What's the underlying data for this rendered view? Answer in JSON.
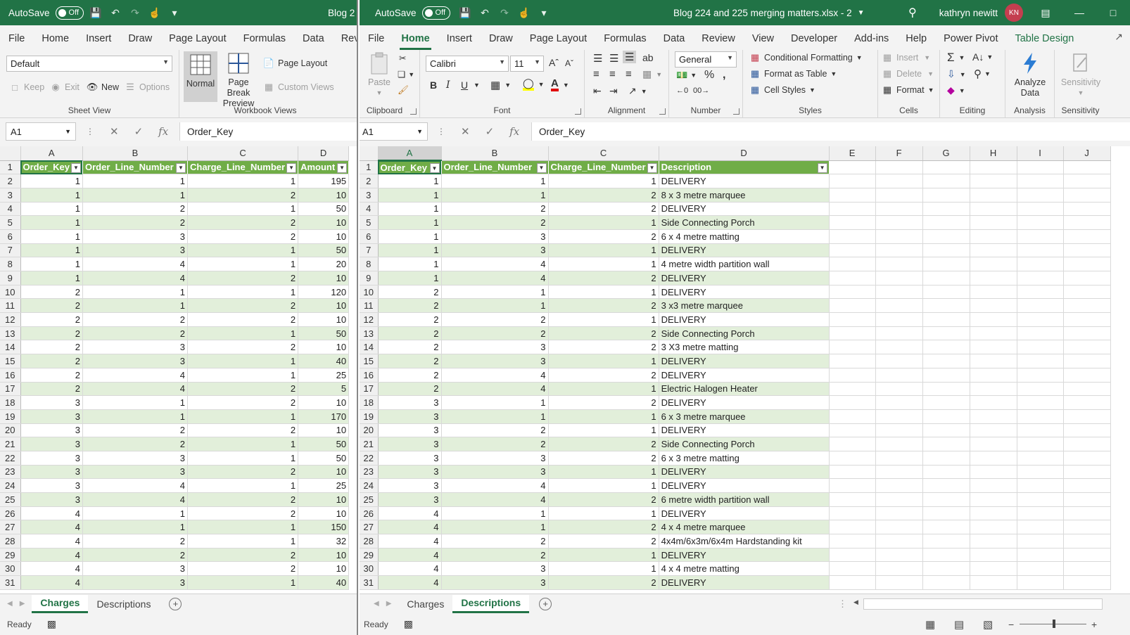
{
  "colors": {
    "excel_green": "#217346",
    "table_header": "#70ad47",
    "table_band": "#e2efda",
    "avatar": "#c43e4f"
  },
  "left": {
    "title": {
      "autosave_label": "AutoSave",
      "autosave_state": "Off",
      "doc_partial": "Blog 2"
    },
    "menu": [
      "File",
      "Home",
      "Insert",
      "Draw",
      "Page Layout",
      "Formulas",
      "Data",
      "Revi"
    ],
    "ribbon": {
      "sheet_view_value": "Default",
      "keep": "Keep",
      "exit": "Exit",
      "new": "New",
      "options": "Options",
      "sheet_view_group": "Sheet View",
      "normal": "Normal",
      "page_break_preview_1": "Page Break",
      "page_break_preview_2": "Preview",
      "page_layout": "Page Layout",
      "custom_views": "Custom Views",
      "workbook_views_group": "Workbook Views"
    },
    "formula": {
      "name_box": "A1",
      "value": "Order_Key"
    },
    "columns": [
      "A",
      "B",
      "C",
      "D"
    ],
    "headers": [
      "Order_Key",
      "Order_Line_Number",
      "Charge_Line_Number",
      "Amount"
    ],
    "rows": [
      [
        1,
        1,
        1,
        195
      ],
      [
        1,
        1,
        2,
        10
      ],
      [
        1,
        2,
        1,
        50
      ],
      [
        1,
        2,
        2,
        10
      ],
      [
        1,
        3,
        2,
        10
      ],
      [
        1,
        3,
        1,
        50
      ],
      [
        1,
        4,
        1,
        20
      ],
      [
        1,
        4,
        2,
        10
      ],
      [
        2,
        1,
        1,
        120
      ],
      [
        2,
        1,
        2,
        10
      ],
      [
        2,
        2,
        2,
        10
      ],
      [
        2,
        2,
        1,
        50
      ],
      [
        2,
        3,
        2,
        10
      ],
      [
        2,
        3,
        1,
        40
      ],
      [
        2,
        4,
        1,
        25
      ],
      [
        2,
        4,
        2,
        5
      ],
      [
        3,
        1,
        2,
        10
      ],
      [
        3,
        1,
        1,
        170
      ],
      [
        3,
        2,
        2,
        10
      ],
      [
        3,
        2,
        1,
        50
      ],
      [
        3,
        3,
        1,
        50
      ],
      [
        3,
        3,
        2,
        10
      ],
      [
        3,
        4,
        1,
        25
      ],
      [
        3,
        4,
        2,
        10
      ],
      [
        4,
        1,
        2,
        10
      ],
      [
        4,
        1,
        1,
        150
      ],
      [
        4,
        2,
        1,
        32
      ],
      [
        4,
        2,
        2,
        10
      ],
      [
        4,
        3,
        2,
        10
      ],
      [
        4,
        3,
        1,
        40
      ]
    ],
    "tabs": [
      "Charges",
      "Descriptions"
    ],
    "active_tab": 0,
    "status": "Ready"
  },
  "right": {
    "title": {
      "autosave_label": "AutoSave",
      "autosave_state": "Off",
      "doc": "Blog 224 and 225 merging matters.xlsx  -  2",
      "user": "kathryn newitt",
      "initials": "KN"
    },
    "menu": [
      "File",
      "Home",
      "Insert",
      "Draw",
      "Page Layout",
      "Formulas",
      "Data",
      "Review",
      "View",
      "Developer",
      "Add-ins",
      "Help",
      "Power Pivot",
      "Table Design"
    ],
    "ribbon": {
      "paste": "Paste",
      "clipboard_group": "Clipboard",
      "font_name": "Calibri",
      "font_size": "11",
      "font_group": "Font",
      "alignment_group": "Alignment",
      "number_format": "General",
      "number_group": "Number",
      "conditional_formatting": "Conditional Formatting",
      "format_as_table": "Format as Table",
      "cell_styles": "Cell Styles",
      "styles_group": "Styles",
      "insert": "Insert",
      "delete": "Delete",
      "format": "Format",
      "cells_group": "Cells",
      "editing_group": "Editing",
      "analyze_1": "Analyze",
      "analyze_2": "Data",
      "analysis_group": "Analysis",
      "sensitivity": "Sensitivity",
      "sensitivity_group": "Sensitivity"
    },
    "formula": {
      "name_box": "A1",
      "value": "Order_Key"
    },
    "columns": [
      "A",
      "B",
      "C",
      "D",
      "E",
      "F",
      "G",
      "H",
      "I",
      "J"
    ],
    "headers": [
      "Order_Key",
      "Order_Line_Number",
      "Charge_Line_Number",
      "Description"
    ],
    "rows": [
      [
        1,
        1,
        1,
        "DELIVERY"
      ],
      [
        1,
        1,
        2,
        "8 x 3 metre marquee"
      ],
      [
        1,
        2,
        2,
        "DELIVERY"
      ],
      [
        1,
        2,
        1,
        "Side Connecting Porch"
      ],
      [
        1,
        3,
        2,
        "6 x 4 metre matting"
      ],
      [
        1,
        3,
        1,
        "DELIVERY"
      ],
      [
        1,
        4,
        1,
        "4 metre width partition wall"
      ],
      [
        1,
        4,
        2,
        "DELIVERY"
      ],
      [
        2,
        1,
        1,
        "DELIVERY"
      ],
      [
        2,
        1,
        2,
        "3 x3 metre marquee"
      ],
      [
        2,
        2,
        1,
        "DELIVERY"
      ],
      [
        2,
        2,
        2,
        "Side Connecting Porch"
      ],
      [
        2,
        3,
        2,
        "3 X3 metre matting"
      ],
      [
        2,
        3,
        1,
        "DELIVERY"
      ],
      [
        2,
        4,
        2,
        "DELIVERY"
      ],
      [
        2,
        4,
        1,
        "Electric Halogen Heater"
      ],
      [
        3,
        1,
        2,
        "DELIVERY"
      ],
      [
        3,
        1,
        1,
        "6 x 3 metre marquee"
      ],
      [
        3,
        2,
        1,
        "DELIVERY"
      ],
      [
        3,
        2,
        2,
        "Side Connecting Porch"
      ],
      [
        3,
        3,
        2,
        "6 x 3 metre matting"
      ],
      [
        3,
        3,
        1,
        "DELIVERY"
      ],
      [
        3,
        4,
        1,
        "DELIVERY"
      ],
      [
        3,
        4,
        2,
        "6 metre width partition wall"
      ],
      [
        4,
        1,
        1,
        "DELIVERY"
      ],
      [
        4,
        1,
        2,
        "4 x 4 metre marquee"
      ],
      [
        4,
        2,
        2,
        "4x4m/6x3m/6x4m Hardstanding kit"
      ],
      [
        4,
        2,
        1,
        "DELIVERY"
      ],
      [
        4,
        3,
        1,
        "4 x 4 metre matting"
      ],
      [
        4,
        3,
        2,
        "DELIVERY"
      ]
    ],
    "tabs": [
      "Charges",
      "Descriptions"
    ],
    "active_tab": 1,
    "status": "Ready"
  }
}
